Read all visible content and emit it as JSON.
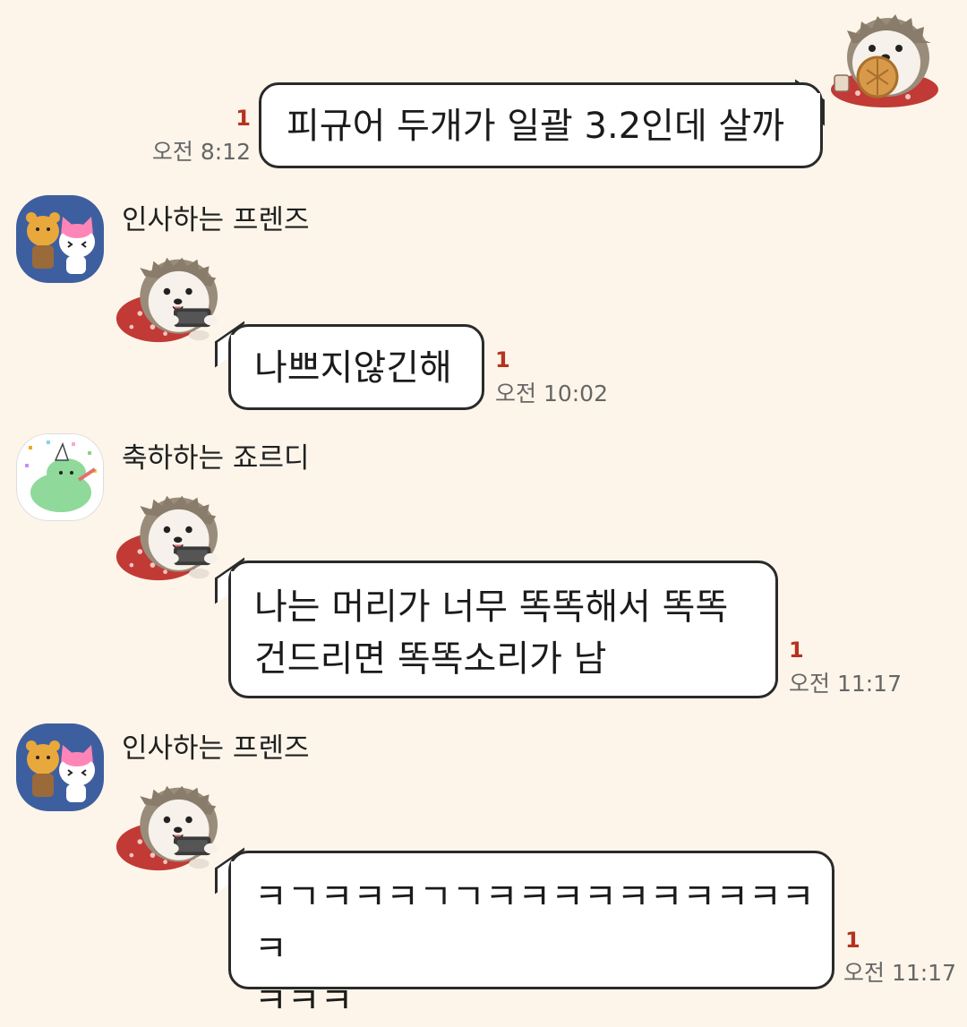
{
  "messages": [
    {
      "direction": "outgoing",
      "text": "피규어 두개가 일괄 3.2인데 살까",
      "unread": "1",
      "time": "오전 8:12",
      "sticker": "hedgehog-eating-cookie-sticker"
    },
    {
      "direction": "incoming",
      "sender": "인사하는 프렌즈",
      "avatar": "ryan-and-apeach-avatar",
      "sticker": "hedgehog-with-phone-sticker",
      "text": "나쁘지않긴해",
      "unread": "1",
      "time": "오전 10:02"
    },
    {
      "direction": "incoming",
      "sender": "축하하는 죠르디",
      "avatar": "jordy-party-avatar",
      "sticker": "hedgehog-with-phone-sticker",
      "lines": [
        "나는 머리가 너무 똑똑해서 똑똑",
        "건드리면 똑똑소리가 남"
      ],
      "unread": "1",
      "time": "오전 11:17"
    },
    {
      "direction": "incoming",
      "sender": "인사하는 프렌즈",
      "avatar": "ryan-and-apeach-avatar",
      "sticker": "hedgehog-with-phone-sticker",
      "lines": [
        "ㅋㄱㅋㅋㅋㄱㄱㅋㅋㅋㅋㅋㅋㅋㅋㅋㅋㅋ",
        "ㅋㅋㅋ"
      ],
      "unread": "1",
      "time": "오전 11:17"
    }
  ],
  "colors": {
    "background": "#fdf5ea",
    "bubble": "#ffffff",
    "bubble_border": "#2a2a2a",
    "unread": "#b5331f",
    "time": "#666666",
    "avatar_blue": "#3e5f9f"
  }
}
